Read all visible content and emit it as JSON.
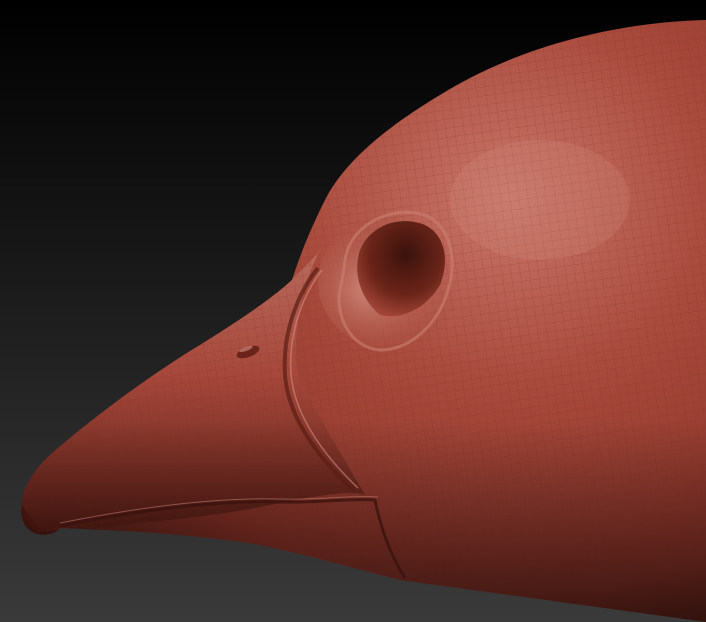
{
  "scene": {
    "subject": "sculpted-bird-head",
    "material": "clay",
    "colors": {
      "background_top": "#000000",
      "background_bottom": "#3a3a3a",
      "clay_base": "#9a3a2e",
      "clay_highlight": "#c9776a",
      "clay_shadow": "#4a1a14",
      "wire": "#7a2a20"
    }
  }
}
